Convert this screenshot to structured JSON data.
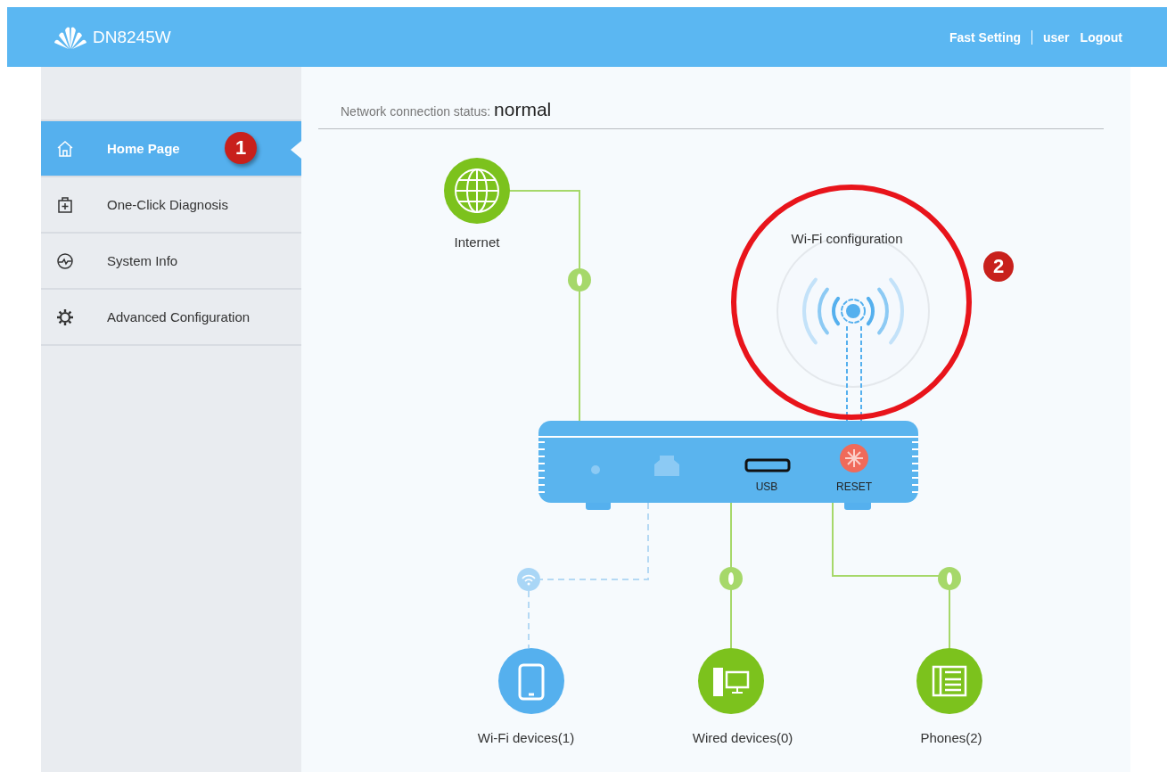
{
  "header": {
    "product": "DN8245W",
    "links": [
      {
        "label": "Fast Setting"
      },
      {
        "label": "user"
      },
      {
        "label": "Logout"
      }
    ]
  },
  "sidebar": {
    "items": [
      {
        "label": "Home Page",
        "selected": true,
        "badge": "1"
      },
      {
        "label": "One-Click Diagnosis",
        "selected": false
      },
      {
        "label": "System Info",
        "selected": false
      },
      {
        "label": "Advanced Configuration",
        "selected": false
      }
    ]
  },
  "status": {
    "label": "Network connection status:",
    "value": "normal"
  },
  "diagram": {
    "internet": "Internet",
    "wifi_config": "Wi-Fi configuration",
    "wifi_badge": "2",
    "router": {
      "ports": [
        "USB",
        "RESET"
      ]
    },
    "devices": [
      {
        "label": "Wi-Fi devices(1)",
        "kind": "wireless"
      },
      {
        "label": "Wired devices(0)",
        "kind": "wired"
      },
      {
        "label": "Phones(2)",
        "kind": "phone"
      }
    ]
  }
}
